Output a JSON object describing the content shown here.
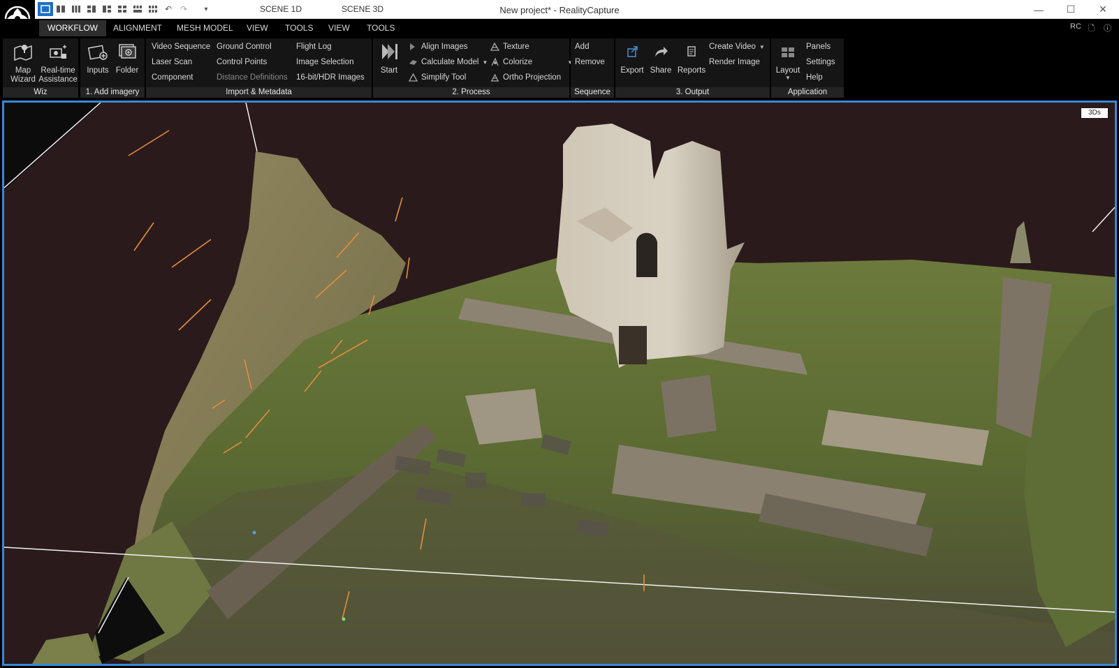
{
  "window": {
    "title": "New project* - RealityCapture",
    "scene_tabs": [
      "SCENE 1D",
      "SCENE 3D"
    ],
    "controls": {
      "minimize": "—",
      "maximize": "☐",
      "close": "✕"
    },
    "quick_access_icons": [
      "layout-1-icon",
      "layout-2-icon",
      "layout-3-icon",
      "layout-4-icon",
      "layout-5-icon",
      "layout-6-icon",
      "layout-7-icon",
      "layout-8-icon",
      "undo-icon",
      "redo-icon",
      "customize-icon"
    ]
  },
  "menu": {
    "items": [
      "WORKFLOW",
      "ALIGNMENT",
      "MESH MODEL",
      "VIEW",
      "TOOLS",
      "VIEW",
      "TOOLS"
    ],
    "active": "WORKFLOW",
    "right": {
      "rc": "RC",
      "doc_icon": "document-icon",
      "help_icon": "help-icon"
    }
  },
  "ribbon": {
    "wiz": {
      "label": "Wiz",
      "map_wizard": "Map Wizard",
      "realtime_assistance": "Real-time Assistance"
    },
    "add_imagery": {
      "label": "1. Add imagery",
      "inputs": "Inputs",
      "folder": "Folder"
    },
    "import_metadata": {
      "label": "Import & Metadata",
      "col1": [
        "Video Sequence",
        "Laser Scan",
        "Component"
      ],
      "col2": [
        "Ground Control",
        "Control Points",
        "Distance Definitions"
      ],
      "col3": [
        "Flight Log",
        "Image Selection",
        "16-bit/HDR Images"
      ]
    },
    "process": {
      "label": "2. Process",
      "start": "Start",
      "col1": [
        "Align Images",
        "Calculate Model",
        "Simplify Tool"
      ],
      "col2": [
        "Texture",
        "Colorize",
        "Ortho Projection"
      ]
    },
    "sequence": {
      "label": "Sequence",
      "add": "Add",
      "remove": "Remove"
    },
    "output": {
      "label": "3. Output",
      "export": "Export",
      "share": "Share",
      "reports": "Reports",
      "create_video": "Create Video",
      "render_image": "Render Image"
    },
    "application": {
      "label": "Application",
      "layout": "Layout",
      "items": [
        "Panels",
        "Settings",
        "Help"
      ]
    }
  },
  "viewport": {
    "badge": "3Ds",
    "border_color": "#3a88d6",
    "background": "#2a1a1c"
  },
  "colors": {
    "accent": "#1f6fc5",
    "ribbon_bg": "#151515",
    "group_label_bg": "#232323"
  }
}
